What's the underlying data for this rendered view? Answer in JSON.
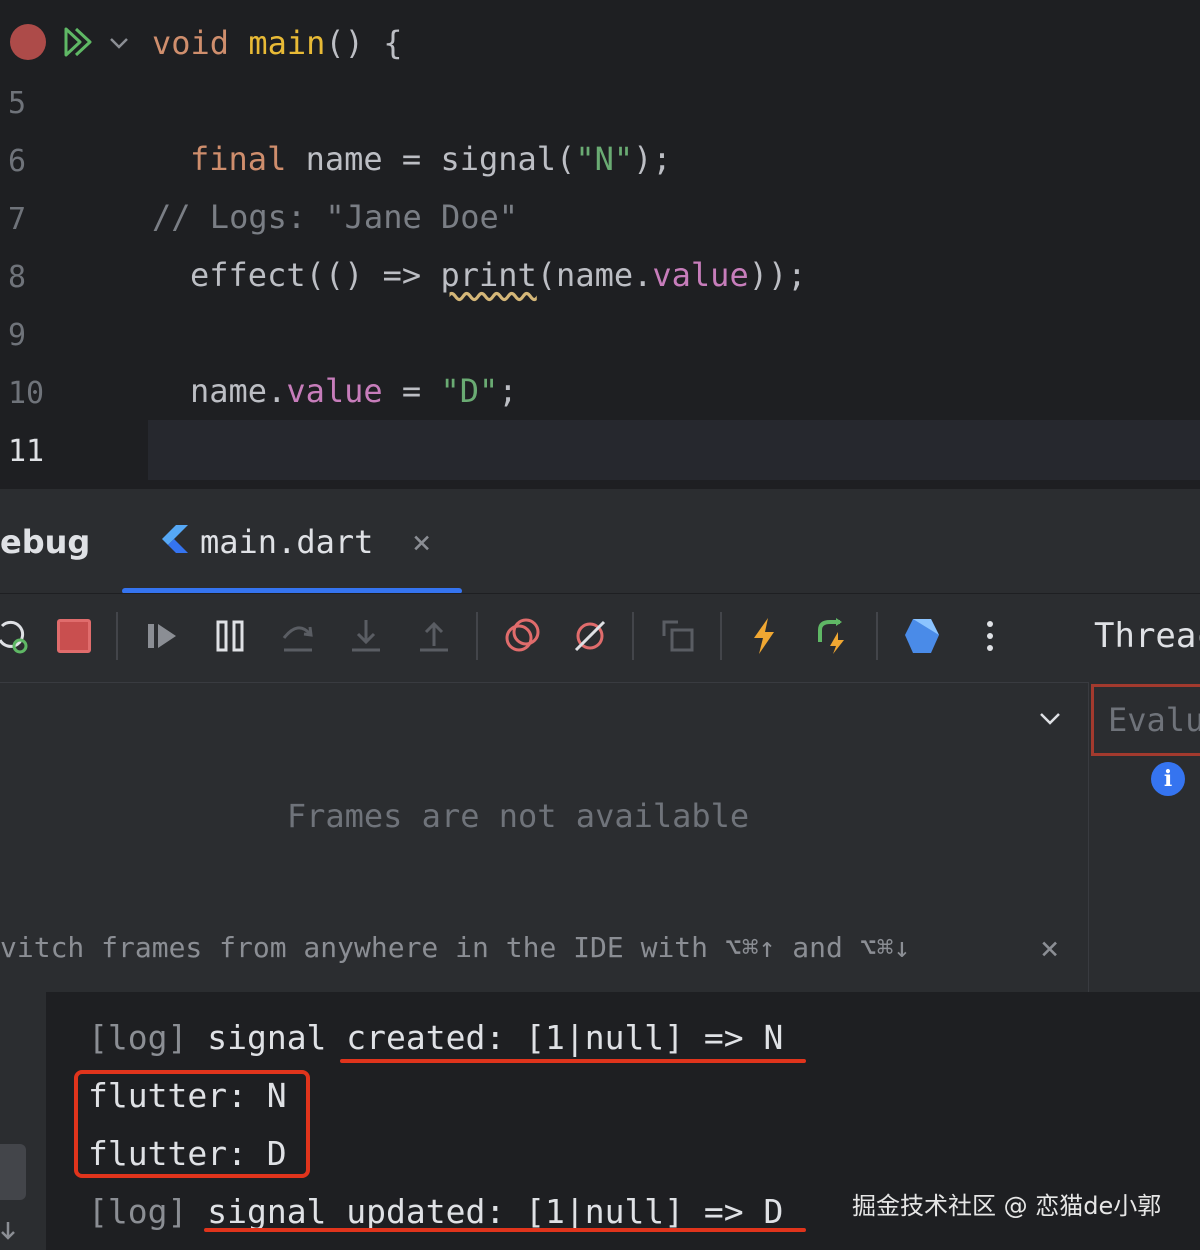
{
  "editor": {
    "line_numbers": [
      "5",
      "6",
      "7",
      "8",
      "9",
      "10",
      "11"
    ],
    "line1": {
      "kw": "void",
      "fn": "main",
      "rest": "() {"
    },
    "line6": {
      "kw": "final",
      "mid": " name = ",
      "fn": "signal",
      "p1": "(",
      "str": "\"N\"",
      "p2": ");"
    },
    "line7": {
      "comment": "// Logs: \"Jane Doe\""
    },
    "line8": {
      "a": "effect(() => ",
      "print": "print",
      "b": "(name.",
      "prop": "value",
      "c": "));"
    },
    "line10": {
      "a": "name.",
      "prop": "value",
      "b": " = ",
      "str": "\"D\"",
      "c": ";"
    }
  },
  "debug": {
    "tab_partial_label": "ebug",
    "file_tab": "main.dart",
    "close_glyph": "×",
    "threads_label": "Threac",
    "evaluate_placeholder": "Evalu",
    "frames_empty": "Frames are not available",
    "frames_hint": "vitch frames from anywhere in the IDE with ⌥⌘↑ and ⌥⌘↓"
  },
  "console": {
    "lines": [
      {
        "prefix": "[log] ",
        "text": "signal created: [1|null] => N"
      },
      {
        "text": "flutter: N"
      },
      {
        "text": "flutter: D"
      },
      {
        "prefix": "[log] ",
        "text": "signal updated: [1|null] => D"
      }
    ]
  },
  "watermark": "掘金技术社区 @ 恋猫de小郭",
  "colors": {
    "annotation_red": "#e0341c",
    "accent_blue": "#3574f0",
    "breakpoint_red": "#c75450"
  }
}
